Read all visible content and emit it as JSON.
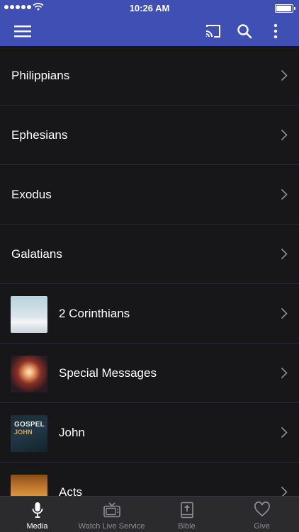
{
  "status_bar": {
    "time": "10:26 AM"
  },
  "app_bar": {
    "icons": [
      "menu-icon",
      "cast-icon",
      "search-icon",
      "more-vertical-icon"
    ]
  },
  "list": {
    "items": [
      {
        "label": "Philippians"
      },
      {
        "label": "Ephesians"
      },
      {
        "label": "Exodus"
      },
      {
        "label": "Galatians"
      },
      {
        "label": "2 Corinthians"
      },
      {
        "label": "Special Messages"
      },
      {
        "label": "John",
        "thumb_text": [
          "GOSPEL",
          "JOHN"
        ]
      },
      {
        "label": "Acts"
      }
    ]
  },
  "tabs": [
    {
      "label": "Media",
      "icon": "microphone-icon",
      "active": true
    },
    {
      "label": "Watch Live Service",
      "icon": "tv-icon",
      "active": false
    },
    {
      "label": "Bible",
      "icon": "bible-icon",
      "active": false
    },
    {
      "label": "Give",
      "icon": "heart-icon",
      "active": false
    }
  ],
  "colors": {
    "primary": "#3f4fb3",
    "background": "#17171a",
    "tab_bar": "#2b2b2e",
    "inactive_tab": "#8e8e93"
  }
}
